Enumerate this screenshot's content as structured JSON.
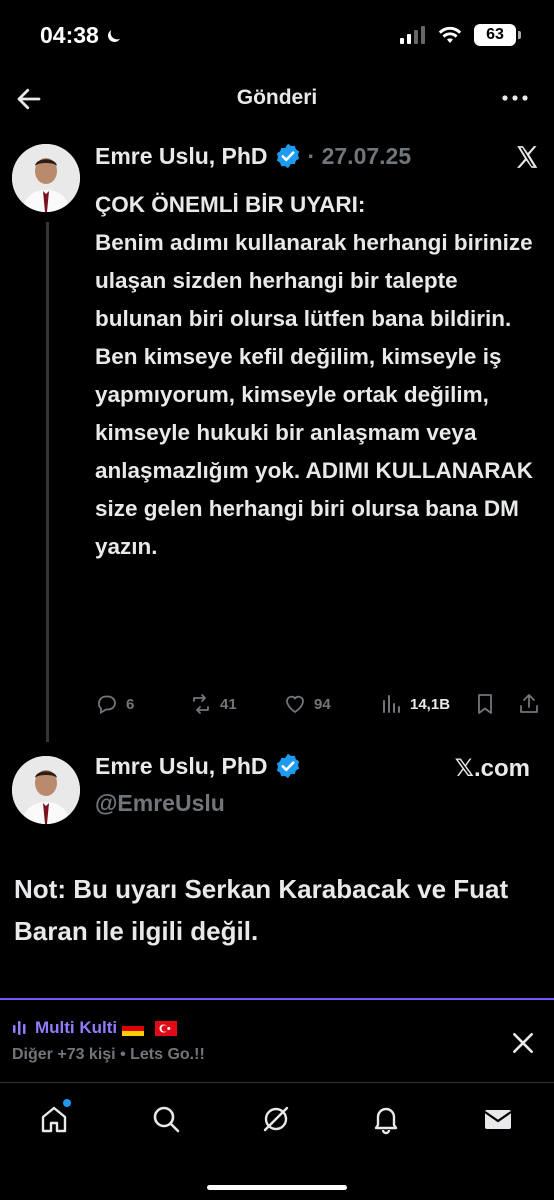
{
  "status_bar": {
    "time": "04:38",
    "battery": "63"
  },
  "header": {
    "title": "Gönderi"
  },
  "tweet": {
    "author_name": "Emre Uslu, PhD",
    "date": "· 27.07.25",
    "text": "ÇOK ÖNEMLİ BİR UYARI:\nBenim adımı kullanarak herhangi birinize ulaşan sizden herhangi bir talepte bulunan biri olursa lütfen bana bildirin. Ben kimseye kefil değilim, kimseyle iş yapmıyorum, kimseyle ortak değilim, kimseyle hukuki bir anlaşmam veya anlaşmazlığım yok. ADIMI KULLANARAK size gelen herhangi biri olursa bana DM yazın.",
    "replies": "6",
    "reposts": "41",
    "likes": "94",
    "views": "14,1B"
  },
  "card": {
    "author_name": "Emre Uslu, PhD",
    "handle": "@EmreUslu",
    "source": "𝕏.com"
  },
  "note": "Not: Bu uyarı Serkan Karabacak ve Fuat Baran ile ilgili değil.",
  "banner": {
    "title": "Multi Kulti",
    "subtitle": "Diğer +73 kişi • Lets Go.!!"
  },
  "tabs": [
    "home-icon",
    "search-icon",
    "grok-icon",
    "notifications-icon",
    "messages-icon"
  ],
  "colors": {
    "accent": "#1d9bf0",
    "spaces": "#8f7cff",
    "muted": "#71767b"
  }
}
